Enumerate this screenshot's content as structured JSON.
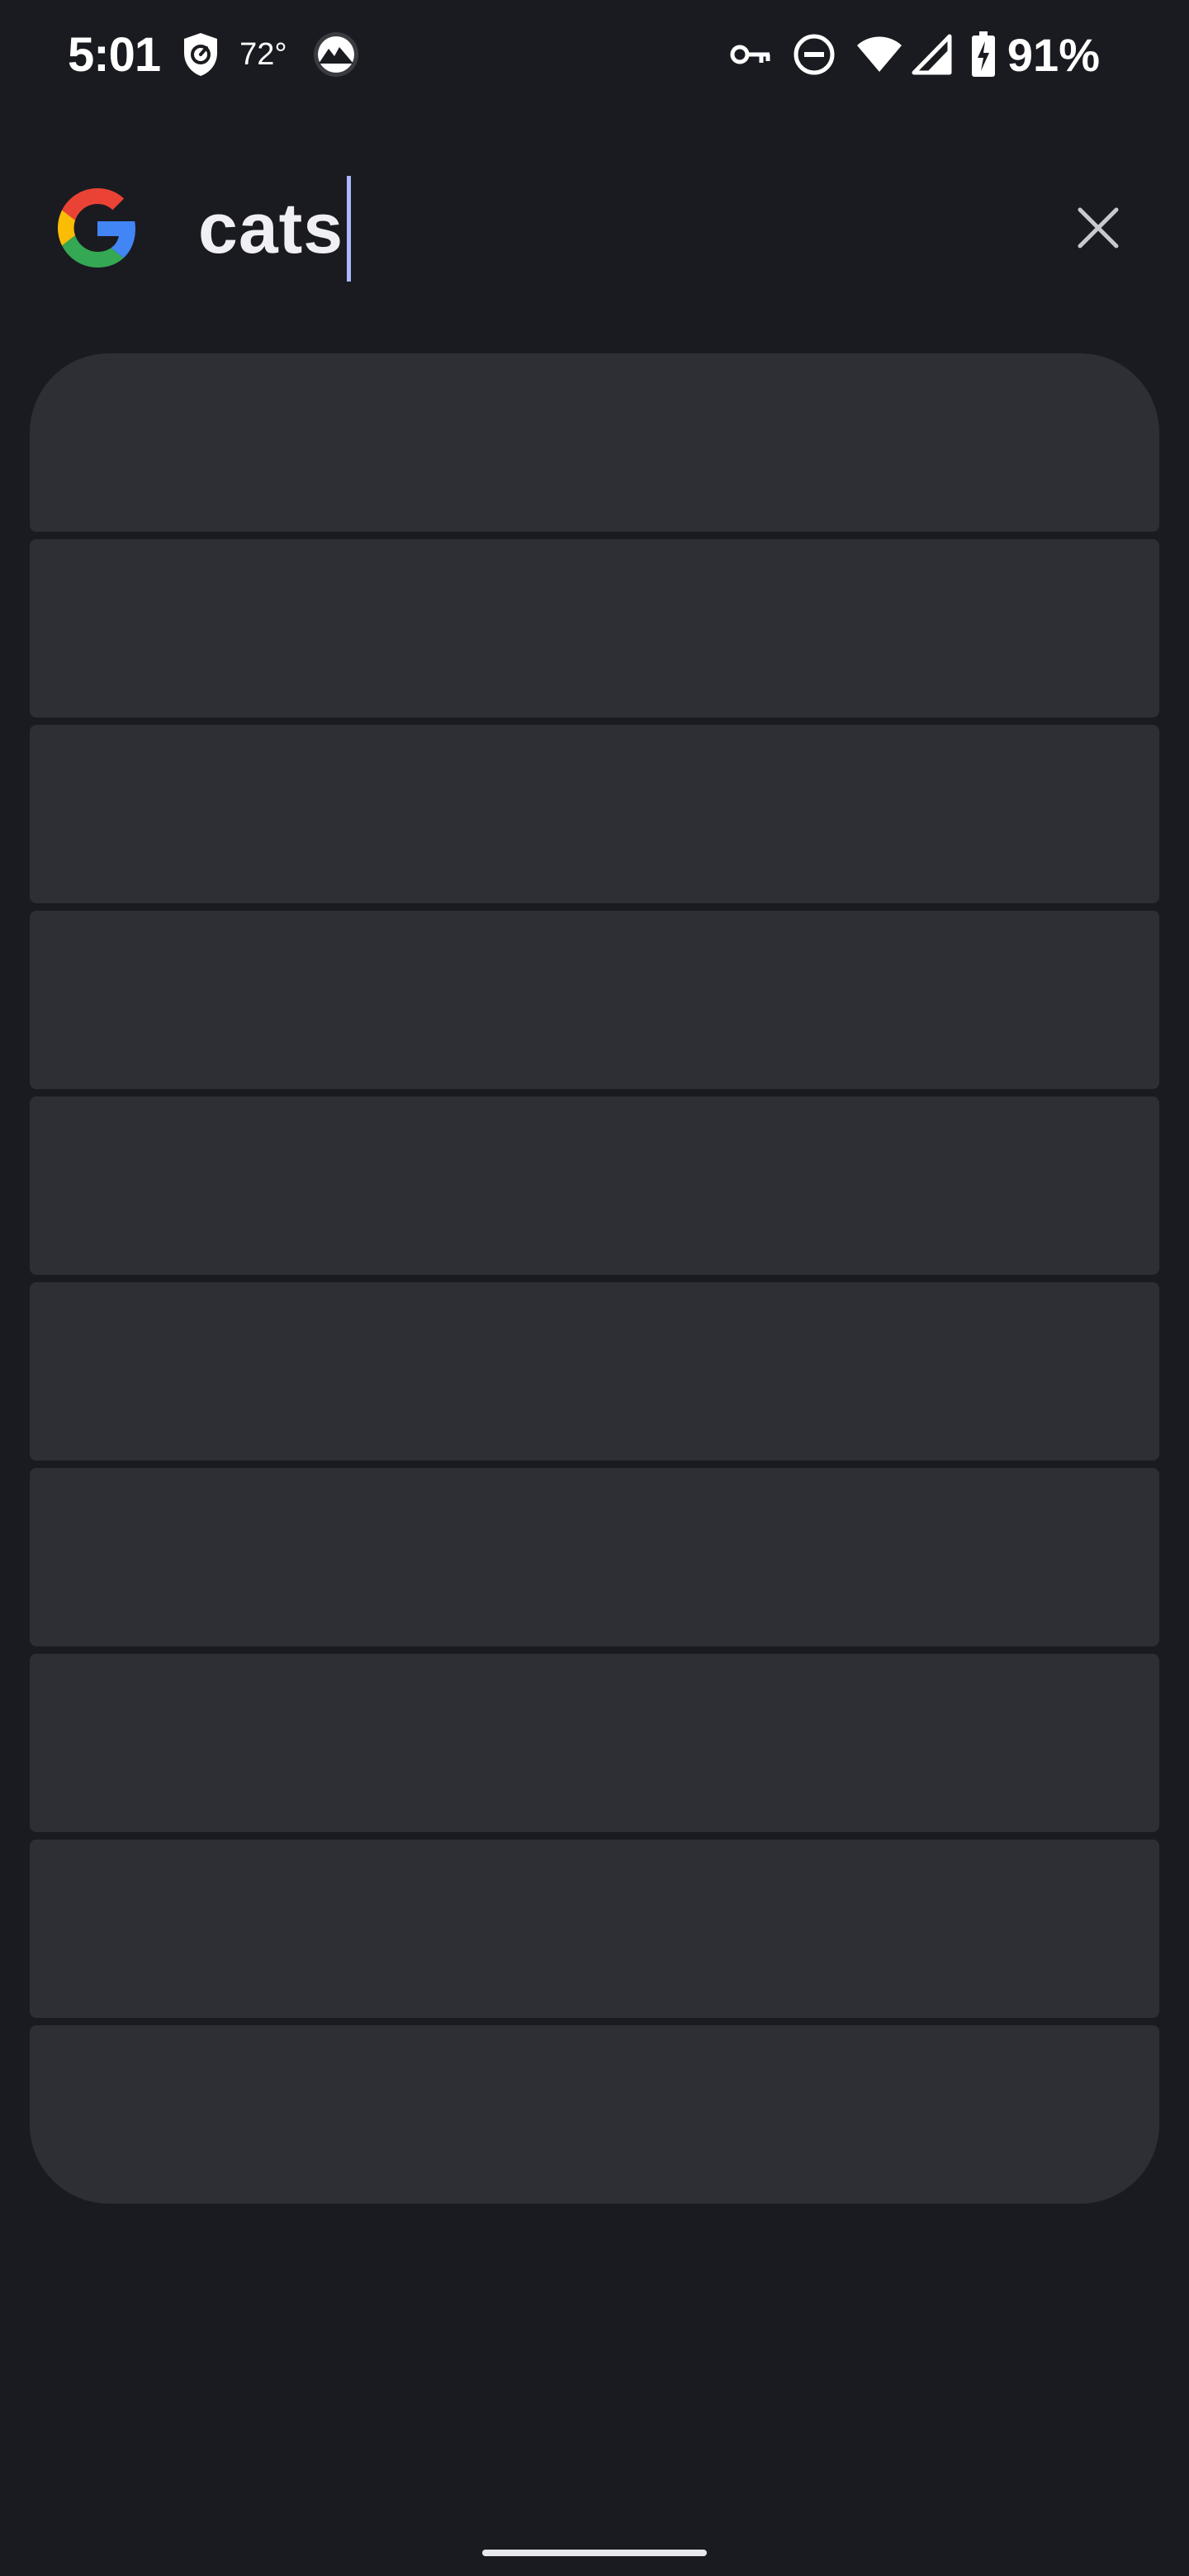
{
  "status_bar": {
    "time": "5:01",
    "temperature": "72°",
    "battery": "91%",
    "icons": [
      "shield-icon",
      "weather-icon",
      "vpn-key-icon",
      "do-not-disturb-icon",
      "wifi-icon",
      "cell-signal-icon",
      "battery-charging-icon"
    ]
  },
  "search": {
    "query": "cats",
    "clear_icon": "close-icon",
    "logo": "google-logo"
  },
  "suggestions": {
    "count": 10,
    "state": "loading"
  },
  "colors": {
    "background": "#1a1b20",
    "card": "#2e2f34",
    "caret": "#aab8ff"
  }
}
